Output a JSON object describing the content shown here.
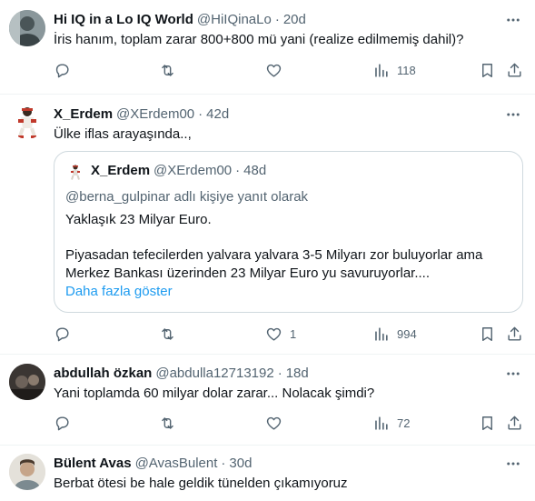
{
  "colors": {
    "text": "#0f1419",
    "secondary": "#536471",
    "link": "#1d9bf0",
    "border": "#eff3f4"
  },
  "tweets": [
    {
      "name": "Hi IQ in a Lo IQ World",
      "handle": "@HiIQinaLo",
      "sep": "·",
      "time": "20d",
      "text": "İris hanım, toplam zarar 800+800 mü yani (realize edilmemiş dahil)?",
      "views": "118"
    },
    {
      "name": "X_Erdem",
      "handle": "@XErdem00",
      "sep": "·",
      "time": "42d",
      "text": "Ülke iflas arayaşında..,",
      "likes": "1",
      "views": "994",
      "quote": {
        "name": "X_Erdem",
        "handle": "@XErdem00",
        "sep": "·",
        "time": "48d",
        "reply_to": "@berna_gulpinar adlı kişiye yanıt olarak",
        "line1": "Yaklaşık 23 Milyar Euro.",
        "line2": "Piyasadan tefecilerden yalvara yalvara 3-5 Milyarı zor buluyorlar ama",
        "line3": "Merkez Bankası üzerinden 23 Milyar Euro yu savuruyorlar....",
        "show_more": "Daha fazla göster"
      }
    },
    {
      "name": "abdullah özkan",
      "handle": "@abdulla12713192",
      "sep": "·",
      "time": "18d",
      "text": "Yani toplamda 60 milyar dolar zarar... Nolacak şimdi?",
      "views": "72"
    },
    {
      "name": "Bülent Avas",
      "handle": "@AvasBulent",
      "sep": "·",
      "time": "30d",
      "text": "Berbat ötesi be hale geldik tünelden çıkamıyoruz"
    }
  ]
}
